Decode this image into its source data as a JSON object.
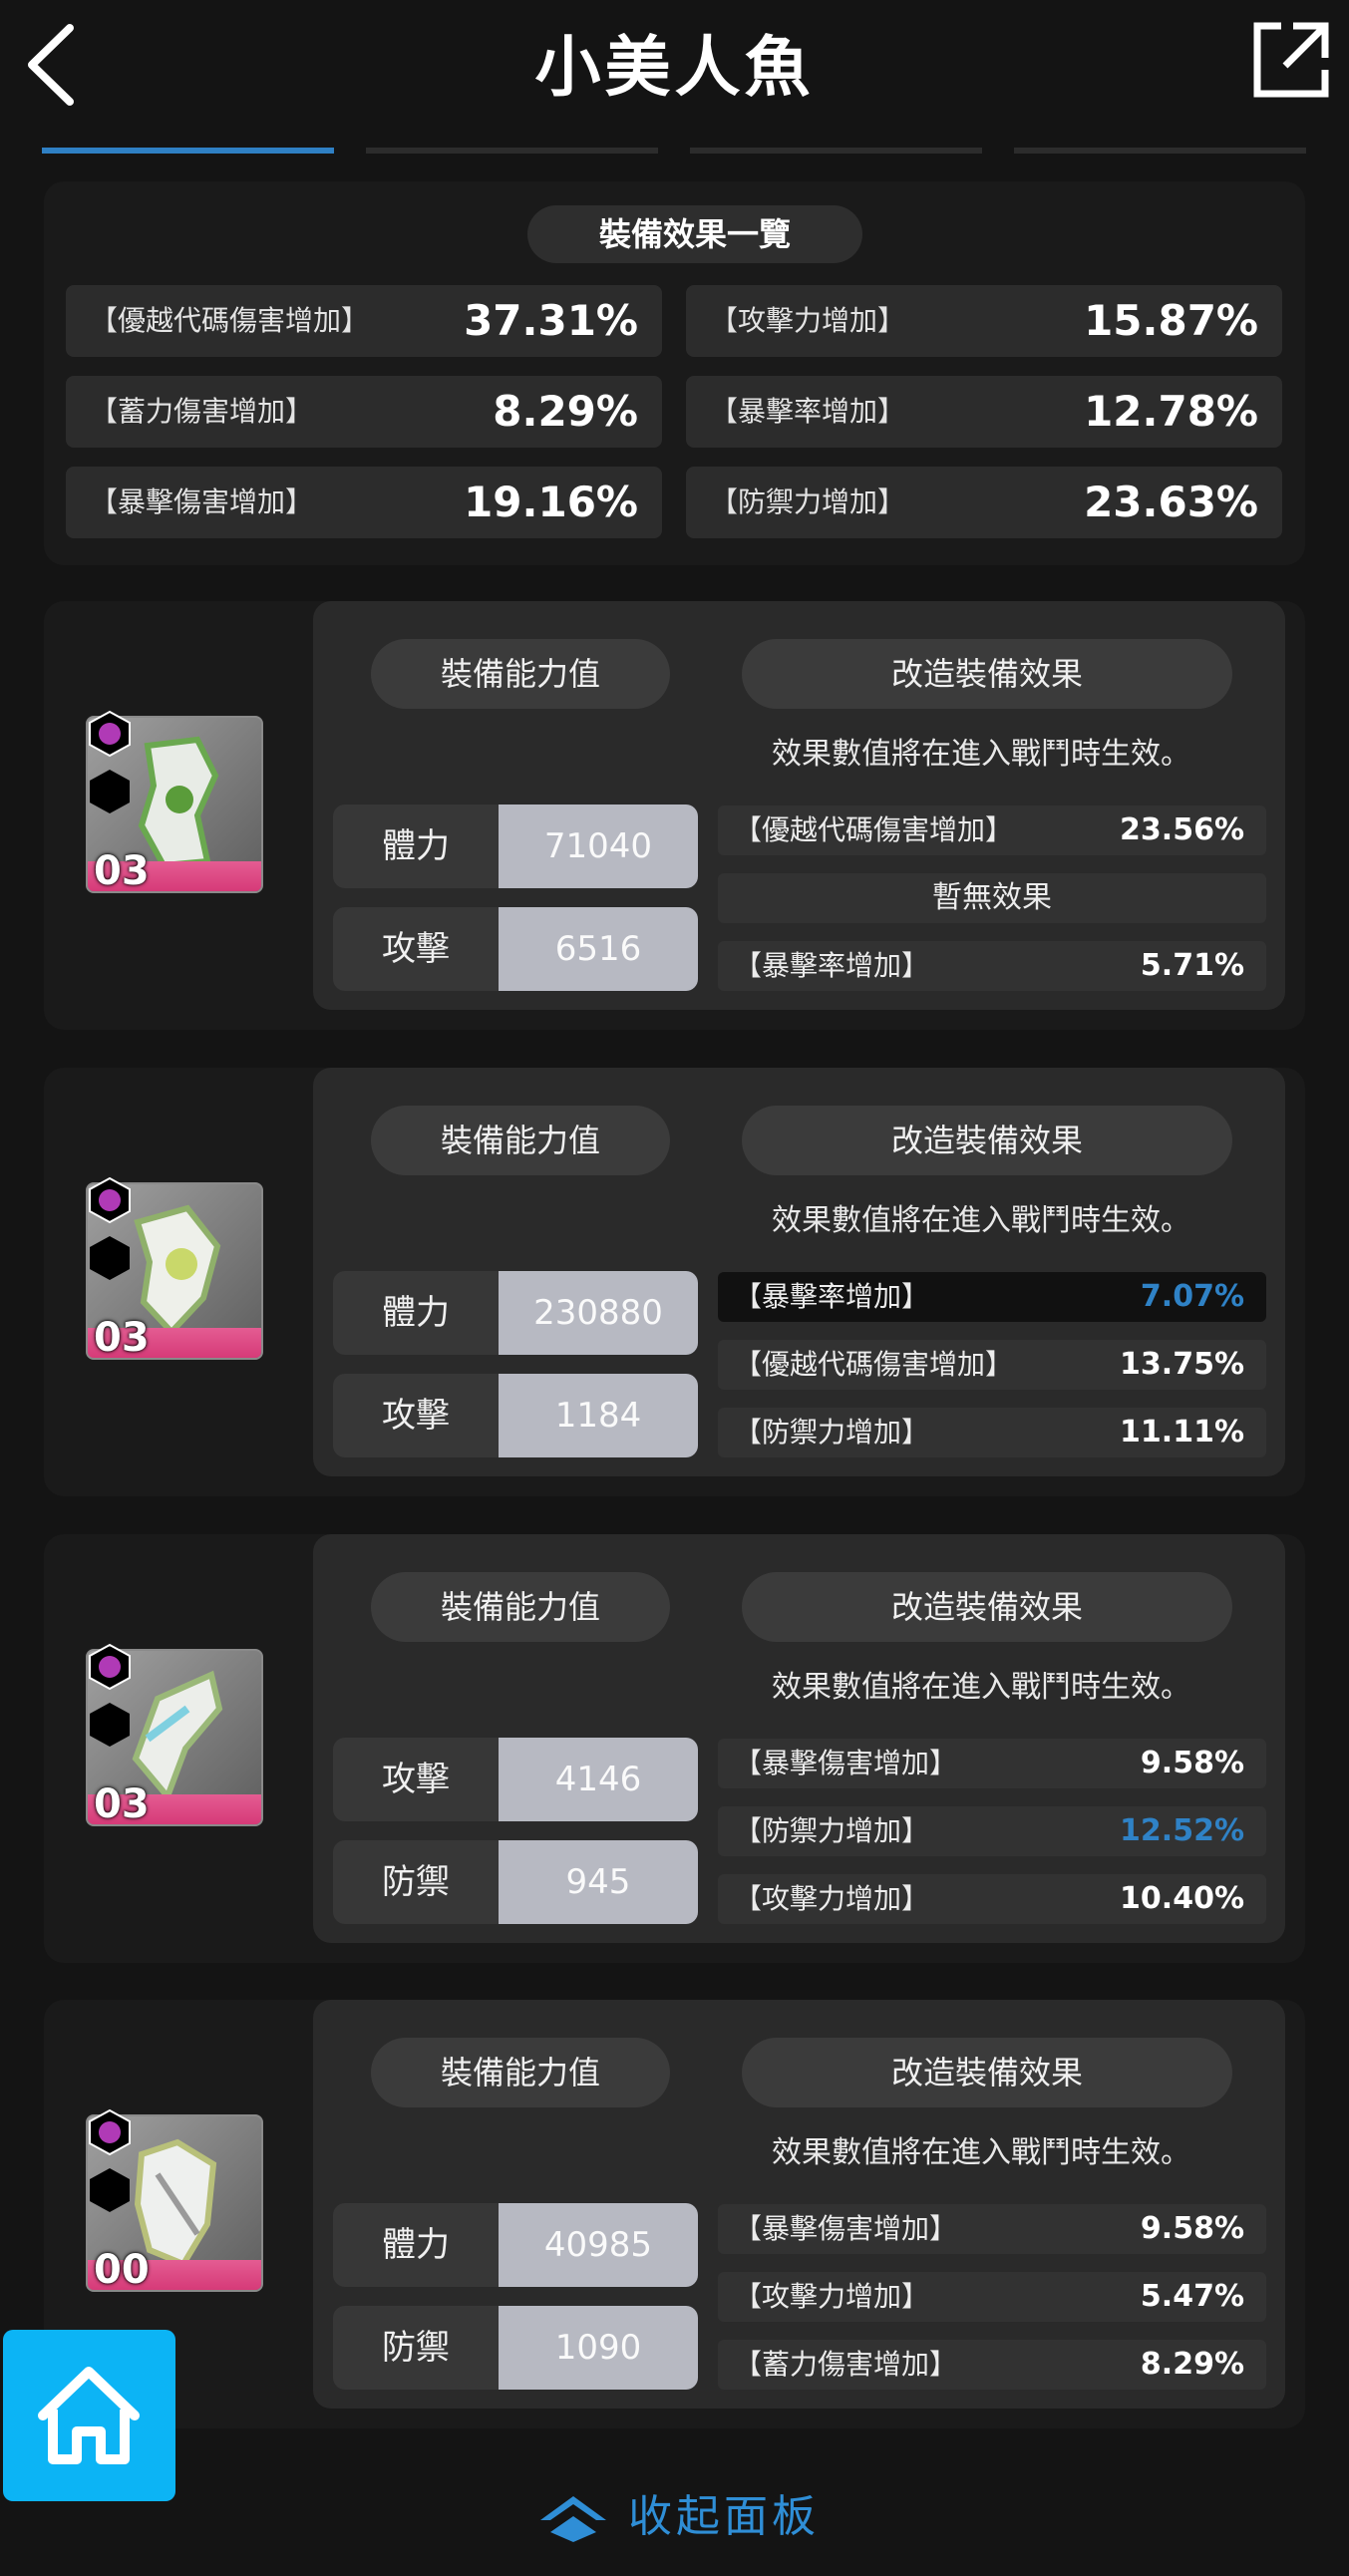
{
  "header": {
    "title": "小美人魚"
  },
  "summary": {
    "title": "裝備效果一覽",
    "items": [
      {
        "label": "【優越代碼傷害增加】",
        "value": "37.31%"
      },
      {
        "label": "【攻擊力增加】",
        "value": "15.87%"
      },
      {
        "label": "【蓄力傷害增加】",
        "value": "8.29%"
      },
      {
        "label": "【暴擊率增加】",
        "value": "12.78%"
      },
      {
        "label": "【暴擊傷害增加】",
        "value": "19.16%"
      },
      {
        "label": "【防禦力增加】",
        "value": "23.63%"
      }
    ]
  },
  "cards": [
    {
      "level": "03",
      "stats_tab": "裝備能力值",
      "effects_tab": "改造裝備效果",
      "note": "效果數值將在進入戰鬥時生效。",
      "stats": [
        {
          "label": "體力",
          "value": "71040"
        },
        {
          "label": "攻擊",
          "value": "6516"
        }
      ],
      "effects": [
        {
          "label": "【優越代碼傷害增加】",
          "value": "23.56%"
        },
        {
          "none": "暫無效果"
        },
        {
          "label": "【暴擊率增加】",
          "value": "5.71%"
        }
      ]
    },
    {
      "level": "03",
      "stats_tab": "裝備能力值",
      "effects_tab": "改造裝備效果",
      "note": "效果數值將在進入戰鬥時生效。",
      "stats": [
        {
          "label": "體力",
          "value": "230880"
        },
        {
          "label": "攻擊",
          "value": "1184"
        }
      ],
      "effects": [
        {
          "label": "【暴擊率增加】",
          "value": "7.07%"
        },
        {
          "label": "【優越代碼傷害增加】",
          "value": "13.75%"
        },
        {
          "label": "【防禦力增加】",
          "value": "11.11%"
        }
      ]
    },
    {
      "level": "03",
      "stats_tab": "裝備能力值",
      "effects_tab": "改造裝備效果",
      "note": "效果數值將在進入戰鬥時生效。",
      "stats": [
        {
          "label": "攻擊",
          "value": "4146"
        },
        {
          "label": "防禦",
          "value": "945"
        }
      ],
      "effects": [
        {
          "label": "【暴擊傷害增加】",
          "value": "9.58%"
        },
        {
          "label": "【防禦力增加】",
          "value": "12.52%"
        },
        {
          "label": "【攻擊力增加】",
          "value": "10.40%"
        }
      ]
    },
    {
      "level": "00",
      "stats_tab": "裝備能力值",
      "effects_tab": "改造裝備效果",
      "note": "效果數值將在進入戰鬥時生效。",
      "stats": [
        {
          "label": "體力",
          "value": "40985"
        },
        {
          "label": "防禦",
          "value": "1090"
        }
      ],
      "effects": [
        {
          "label": "【暴擊傷害增加】",
          "value": "9.58%"
        },
        {
          "label": "【攻擊力增加】",
          "value": "5.47%"
        },
        {
          "label": "【蓄力傷害增加】",
          "value": "8.29%"
        }
      ]
    }
  ],
  "footer": {
    "collapse_label": "收起面板"
  },
  "colors": {
    "accent": "#2f80c4",
    "highlight": "#2f82c6",
    "home": "#0cb4f5",
    "gear_pink": "#e0507f"
  },
  "icons": {
    "back": "back-arrow-icon",
    "share": "share-external-icon",
    "home": "home-icon",
    "collapse": "chevron-up-icon"
  }
}
